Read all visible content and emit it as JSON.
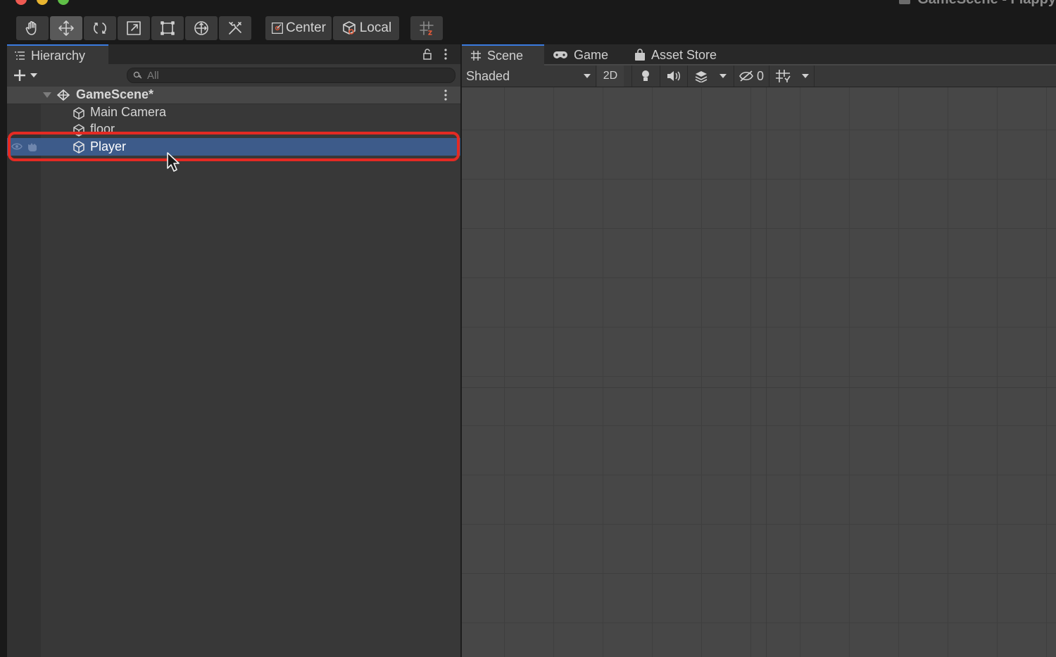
{
  "window": {
    "title": "GameScene - Flappy"
  },
  "toolbar": {
    "tools": [
      {
        "name": "hand-tool",
        "icon": "hand-icon"
      },
      {
        "name": "move-tool",
        "icon": "move-arrows-icon",
        "active": true
      },
      {
        "name": "rotate-tool",
        "icon": "rotate-icon"
      },
      {
        "name": "scale-tool",
        "icon": "scale-icon"
      },
      {
        "name": "rect-tool",
        "icon": "rect-transform-icon"
      },
      {
        "name": "transform-tool",
        "icon": "transform-icon"
      },
      {
        "name": "custom-tool",
        "icon": "custom-tools-icon"
      }
    ],
    "pivot_label": "Center",
    "space_label": "Local"
  },
  "hierarchy": {
    "tab_label": "Hierarchy",
    "search_placeholder": "All",
    "scene_name": "GameScene*",
    "items": [
      {
        "label": "Main Camera"
      },
      {
        "label": "floor"
      },
      {
        "label": "Player",
        "selected": true
      }
    ]
  },
  "scene_view": {
    "tabs": [
      {
        "label": "Scene",
        "icon": "grid-hash-icon",
        "active": true
      },
      {
        "label": "Game",
        "icon": "gamepad-icon"
      },
      {
        "label": "Asset Store",
        "icon": "shopping-bag-icon"
      }
    ],
    "shading_mode": "Shaded",
    "mode_2d_label": "2D",
    "hidden_count": "0"
  },
  "colors": {
    "selection": "#3d5b8a",
    "highlight_box": "#e42a23",
    "tab_accent": "#3a7be0"
  }
}
